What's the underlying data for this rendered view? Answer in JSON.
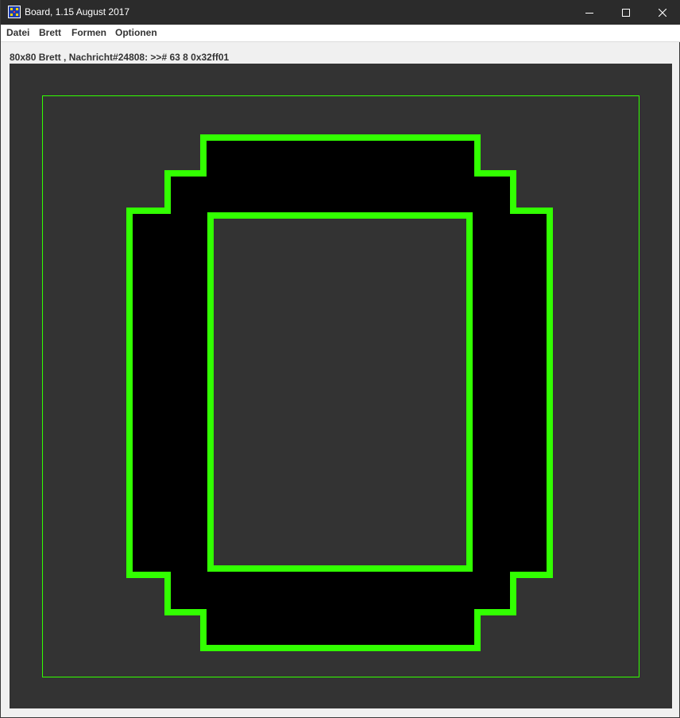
{
  "window": {
    "title": "Board, 1.15 August 2017"
  },
  "menu": {
    "items": [
      {
        "label": "Datei"
      },
      {
        "label": "Brett"
      },
      {
        "label": "Formen"
      },
      {
        "label": "Optionen"
      }
    ]
  },
  "status": {
    "text": "80x80 Brett , Nachricht#24808: >># 63 8 0x32ff01"
  },
  "board": {
    "background_color": "#333333",
    "shape_fill": "#000000",
    "line_color": "#32ff01"
  },
  "icons": {
    "app": "board-app-icon",
    "minimize": "minimize-icon",
    "maximize": "maximize-icon",
    "close": "close-icon"
  }
}
